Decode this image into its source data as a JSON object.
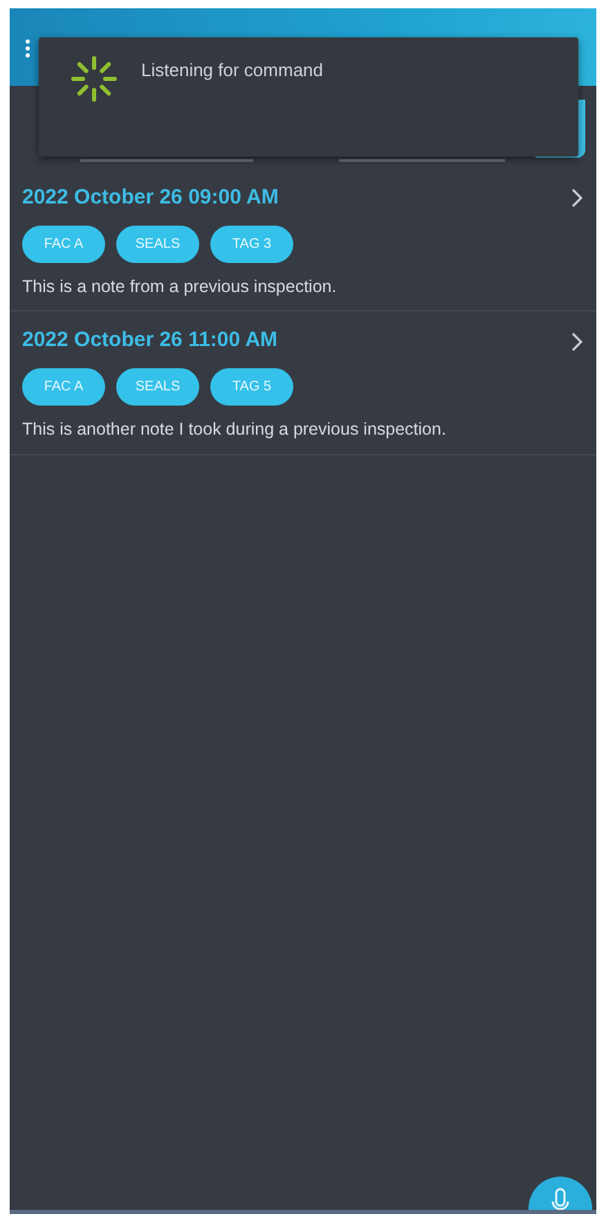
{
  "dialog": {
    "message": "Listening for command"
  },
  "notes": [
    {
      "timestamp": "2022 October 26 09:00 AM",
      "tags": [
        "FAC A",
        "SEALS",
        "TAG 3"
      ],
      "text": "This is a note from a previous inspection."
    },
    {
      "timestamp": "2022 October 26 11:00 AM",
      "tags": [
        "FAC A",
        "SEALS",
        "TAG 5"
      ],
      "text": "This is another note I took during a previous inspection."
    }
  ]
}
